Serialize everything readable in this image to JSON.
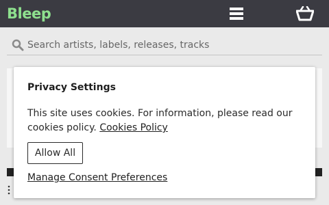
{
  "header": {
    "logo_text": "Bleep",
    "logo_color": "#8ee08e",
    "background_color": "#3b3b42",
    "menu_icon": "hamburger-menu-icon",
    "cart_icon": "basket-icon"
  },
  "search": {
    "placeholder": "Search artists, labels, releases, tracks",
    "icon": "search-icon"
  },
  "consent": {
    "title": "Privacy Settings",
    "body_text": "This site uses cookies. For information, please read our cookies policy.",
    "policy_link": "Cookies Policy",
    "allow_all_label": "Allow All",
    "manage_label": "Manage Consent Preferences"
  }
}
